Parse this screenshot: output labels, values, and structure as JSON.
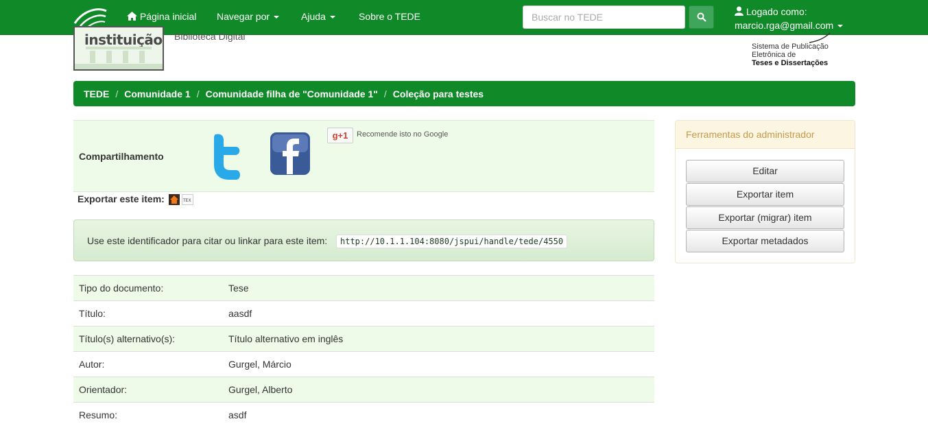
{
  "navbar": {
    "home_label": "Página inicial",
    "browse_label": "Navegar por",
    "help_label": "Ajuda",
    "about_label": "Sobre o TEDE",
    "search_placeholder": "Buscar no TEDE",
    "user_label": "Logado como:",
    "user_email": "marcio.rga@gmail.com"
  },
  "header": {
    "institution_text": "instituição",
    "library_text": "Biblioteca Digital",
    "tede_logo_line1": "Sistema de Publicação",
    "tede_logo_line2": "Eletrônica de",
    "tede_logo_line3": "Teses e Dissertações"
  },
  "breadcrumb": [
    "TEDE",
    "Comunidade 1",
    "Comunidade filha de \"Comunidade 1\"",
    "Coleção para testes"
  ],
  "share": {
    "label": "Compartilhamento",
    "gplus_text": "Recomende isto no Google",
    "gplus_button": "g+1"
  },
  "export": {
    "label": "Exportar este item:"
  },
  "identifier": {
    "label": "Use este identificador para citar ou linkar para este item:",
    "url": "http://10.1.1.104:8080/jspui/handle/tede/4550"
  },
  "metadata": [
    {
      "label": "Tipo do documento:",
      "value": "Tese"
    },
    {
      "label": "Título:",
      "value": "aasdf"
    },
    {
      "label": "Título(s) alternativo(s):",
      "value": "Título alternativo em inglês"
    },
    {
      "label": "Autor:",
      "value": "Gurgel, Márcio"
    },
    {
      "label": "Orientador:",
      "value": "Gurgel, Alberto"
    },
    {
      "label": "Resumo:",
      "value": "asdf"
    }
  ],
  "admin": {
    "title": "Ferramentas do administrador",
    "buttons": [
      "Editar",
      "Exportar item",
      "Exportar (migrar) item",
      "Exportar metadados"
    ]
  },
  "colors": {
    "brand_green": "#108a28",
    "row_tint": "#eefbe9"
  }
}
